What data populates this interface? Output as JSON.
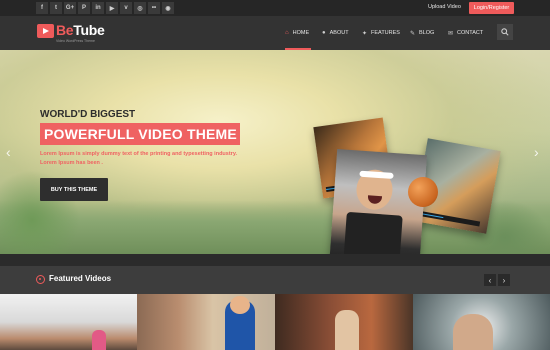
{
  "topbar": {
    "social_icons": [
      {
        "name": "facebook-icon",
        "glyph": "f"
      },
      {
        "name": "twitter-icon",
        "glyph": "t"
      },
      {
        "name": "google-plus-icon",
        "glyph": "G+"
      },
      {
        "name": "pinterest-icon",
        "glyph": "P"
      },
      {
        "name": "linkedin-icon",
        "glyph": "in"
      },
      {
        "name": "youtube-icon",
        "glyph": "▶"
      },
      {
        "name": "vimeo-icon",
        "glyph": "v"
      },
      {
        "name": "dribbble-icon",
        "glyph": "◎"
      },
      {
        "name": "flickr-icon",
        "glyph": "••"
      },
      {
        "name": "github-icon",
        "glyph": "◉"
      }
    ],
    "upload_label": "Upload Video",
    "login_label": "Login/Register"
  },
  "header": {
    "logo_be": "Be",
    "logo_tube": "Tube",
    "tagline": "Video WordPress Theme",
    "nav": {
      "home": "HOME",
      "about": "ABOUT",
      "features": "FEATURES",
      "blog": "BLOG",
      "contact": "CONTACT"
    }
  },
  "hero": {
    "kicker": "WORLD'D BIGGEST",
    "headline": "POWERFULL VIDEO THEME",
    "description": "Lorem Ipsum is simply dummy text of the printing and typesetting industry. Lorem Ipsum has been .",
    "cta_label": "BUY THIS THEME"
  },
  "featured": {
    "title": "Featured Videos"
  },
  "colors": {
    "accent": "#ef5b5b",
    "header_bg": "#333333",
    "topbar_bg": "#262626",
    "featured_bg": "#3d3d3d"
  }
}
